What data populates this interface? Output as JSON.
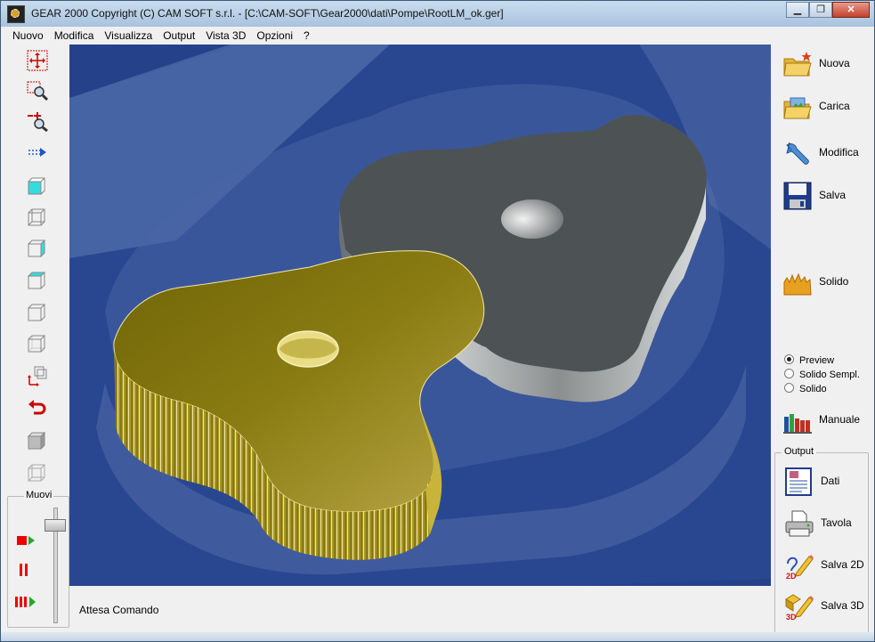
{
  "window": {
    "title": "GEAR 2000     Copyright (C)  CAM SOFT s.r.l. - [C:\\CAM-SOFT\\Gear2000\\dati\\Pompe\\RootLM_ok.ger]",
    "minimize": "▁",
    "restore": "❐",
    "close": "✕"
  },
  "menu": [
    "Nuovo",
    "Modifica",
    "Visualizza",
    "Output",
    "Vista 3D",
    "Opzioni",
    "?"
  ],
  "toolbar": {
    "icons": [
      "move-pan-icon",
      "zoom-window-icon",
      "zoom-in-out-icon",
      "dashed-arrow-icon",
      "cube-front-icon",
      "cube-wire-icon",
      "cube-side-icon",
      "cube-top-icon",
      "cube-wire-2-icon",
      "cube-iso-icon",
      "axes-rotate-icon",
      "undo-arrow-icon",
      "cube-solid-gray-icon",
      "cube-wire-gray-icon"
    ]
  },
  "muovi": {
    "label": "Muovi",
    "buttons": [
      "play-icon",
      "pause-icon",
      "step-forward-icon"
    ]
  },
  "status": {
    "text": "Attesa Comando"
  },
  "right": {
    "nuova": "Nuova",
    "carica": "Carica",
    "modifica": "Modifica",
    "salva": "Salva",
    "solido": "Solido",
    "radio": [
      {
        "label": "Preview",
        "selected": true
      },
      {
        "label": "Solido Sempl.",
        "selected": false
      },
      {
        "label": "Solido",
        "selected": false
      }
    ],
    "manuale": "Manuale",
    "output_group": "Output",
    "dati": "Dati",
    "tavola": "Tavola",
    "salva2d": "Salva 2D",
    "salva3d": "Salva 3D"
  },
  "colors": {
    "viewport_bg": "#24418a",
    "gear_gold": "#8a7a10",
    "gear_gray": "#4d5354",
    "accent_red": "#cc0000"
  }
}
